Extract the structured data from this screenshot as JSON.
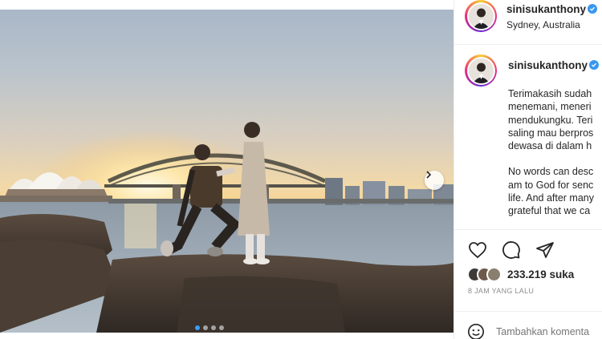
{
  "post": {
    "username": "sinisukanthony",
    "location": "Sydney, Australia",
    "caption_lines": [
      "Terimakasih sudah",
      "menemani, meneri",
      "mendukungku. Teri",
      "saling mau berpros",
      "dewasa di dalam h"
    ],
    "caption_lines_en": [
      "No words can desc",
      "am to God for senc",
      "life. And after many",
      "grateful that we ca"
    ],
    "likes": "233.219 suka",
    "time": "8 JAM YANG LALU",
    "comment_placeholder": "Tambahkan komenta",
    "carousel": {
      "slide_count": 4,
      "active_index": 0
    }
  },
  "icons": {
    "verified": "verified-badge-icon",
    "like": "heart-icon",
    "comment": "comment-icon",
    "share": "share-icon",
    "emoji": "emoji-icon",
    "next": "chevron-right-icon"
  },
  "colors": {
    "verified": "#3897f0",
    "active_dot": "#3b9cff",
    "muted": "#8e8e8e"
  }
}
